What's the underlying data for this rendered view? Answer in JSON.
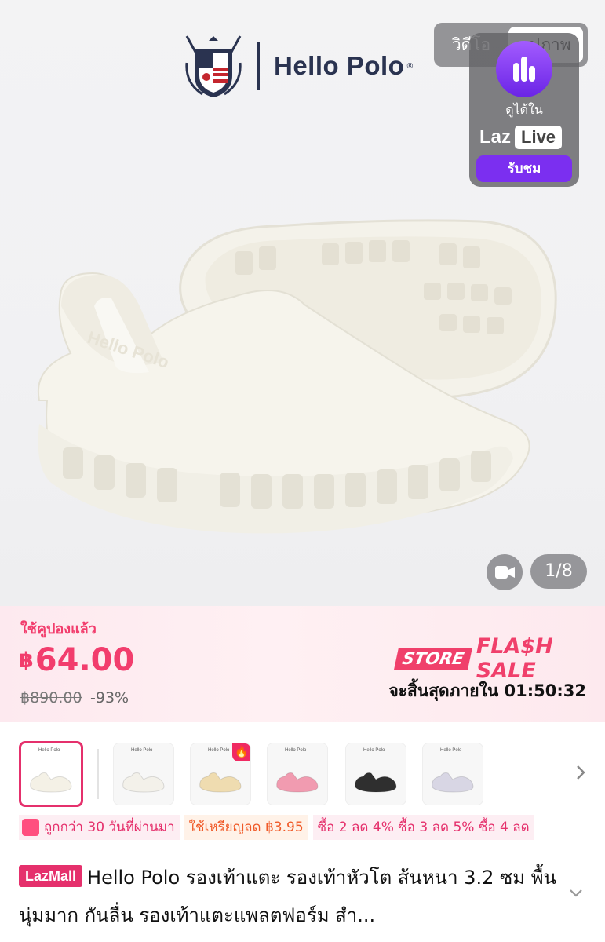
{
  "brand": {
    "name": "Hello Polo",
    "reg": "®"
  },
  "media_tabs": {
    "video": "วิดีโอ",
    "image": "รูปภาพ"
  },
  "lazlive": {
    "watch_in": "ดูได้ใน",
    "laz": "Laz",
    "live": "Live",
    "watch_button": "รับชม"
  },
  "gallery": {
    "counter": "1/8",
    "video_icon": "video-camera-icon"
  },
  "price": {
    "coupon_used": "ใช้คูปองแล้ว",
    "currency": "฿",
    "current": "64.00",
    "original": "฿890.00",
    "discount": "-93%",
    "flash_store": "STORE",
    "flash_sale": "FLA$H SALE",
    "ends_in": "จะสิ้นสุดภายใน 01:50:32",
    "accent": "#f23d6d"
  },
  "variants": {
    "items": [
      {
        "color": "#f4f1e6",
        "selected": true
      },
      {
        "color": "#f3f1ea",
        "selected": false
      },
      {
        "color": "#efdcb0",
        "selected": false,
        "hot": "🔥"
      },
      {
        "color": "#f19bb0",
        "selected": false
      },
      {
        "color": "#2f2f2f",
        "selected": false
      },
      {
        "color": "#d8d6e4",
        "selected": false
      }
    ],
    "mini_logo": "Hello Polo"
  },
  "promos": {
    "lower_than_30_days": "ถูกกว่า 30 วันที่ผ่านมา",
    "coins": "ใช้เหรียญลด ฿3.95",
    "bundle": "ซื้อ 2 ลด 4% ซื้อ 3 ลด 5% ซื้อ 4 ลด"
  },
  "product": {
    "badge": "LazMall",
    "title": "Hello Polo รองเท้าแตะ รองเท้าหัวโต ส้นหนา 3.2 ซม พื้นนุ่มมาก กันลื่น รองเท้าแตะแพลตฟอร์ม สำ..."
  }
}
